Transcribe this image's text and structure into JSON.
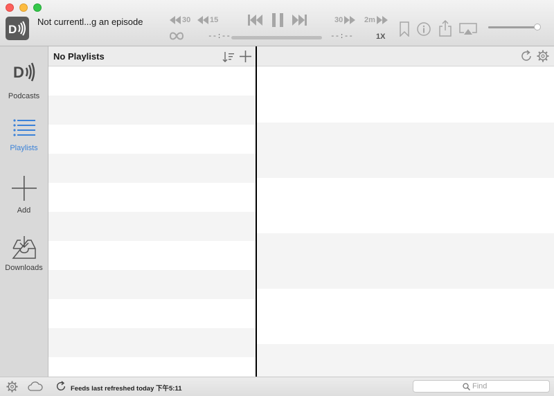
{
  "player": {
    "now_playing": "Not currentl...g an episode",
    "skip_back_long": "30",
    "skip_back_short": "15",
    "skip_fwd_short": "30",
    "skip_fwd_long": "2m",
    "time_elapsed": "--:--",
    "time_remaining": "--:--",
    "speed": "1X"
  },
  "sidebar": {
    "items": [
      {
        "label": "Podcasts"
      },
      {
        "label": "Playlists"
      },
      {
        "label": "Add"
      },
      {
        "label": "Downloads"
      }
    ]
  },
  "playlists_panel": {
    "title": "No Playlists"
  },
  "statusbar": {
    "refresh_text": "Feeds last refreshed today 下午5:11",
    "find_placeholder": "Find"
  },
  "colors": {
    "accent": "#3b82d8"
  },
  "icons": [
    "app-icon",
    "skip-back-30-icon",
    "skip-back-15-icon",
    "previous-icon",
    "pause-icon",
    "next-icon",
    "skip-forward-30-icon",
    "skip-forward-2m-icon",
    "loop-icon",
    "bookmark-icon",
    "info-icon",
    "share-icon",
    "airplay-icon",
    "sort-icon",
    "plus-icon",
    "refresh-icon",
    "gear-icon",
    "cloud-icon",
    "search-icon"
  ]
}
